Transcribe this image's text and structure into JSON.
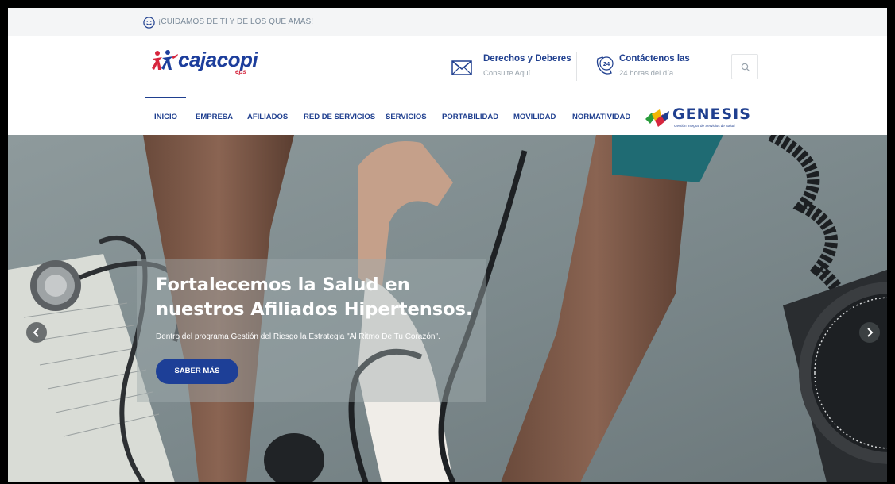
{
  "topbar": {
    "slogan": "¡CUIDAMOS DE TI Y DE LOS QUE AMAS!",
    "icon": "smiley-icon"
  },
  "header": {
    "logo_text": "cajacopi",
    "logo_badge": "eps",
    "info": [
      {
        "icon": "envelope-icon",
        "title": "Derechos y Deberes",
        "subtitle": "Consulte Aquí"
      },
      {
        "icon": "24h-phone-icon",
        "title": "Contáctenos las",
        "subtitle": "24 horas del día"
      }
    ],
    "search_icon": "search-icon"
  },
  "nav": {
    "items": [
      {
        "label": "INICIO",
        "active": true
      },
      {
        "label": "EMPRESA"
      },
      {
        "label": "AFILIADOS"
      },
      {
        "label": "RED DE SERVICIOS"
      },
      {
        "label": "SERVICIOS"
      },
      {
        "label": "PORTABILIDAD"
      },
      {
        "label": "MOVILIDAD"
      },
      {
        "label": "NORMATIVIDAD"
      }
    ],
    "genesis": {
      "title": "GENESIS",
      "subtitle": "Gestión Integral de Servicios de Salud"
    }
  },
  "hero": {
    "heading": "Fortalecemos la Salud en nuestros Afiliados Hipertensos.",
    "description": "Dentro del programa Gestión del Riesgo la Estrategia \"Al Ritmo De Tu Corazón\".",
    "cta_label": "SABER MÁS",
    "prev_icon": "chevron-left-icon",
    "next_icon": "chevron-right-icon"
  },
  "colors": {
    "brand_blue": "#1f3f8f",
    "button_blue": "#1d3f97",
    "topbar_bg": "#f4f5f6"
  }
}
